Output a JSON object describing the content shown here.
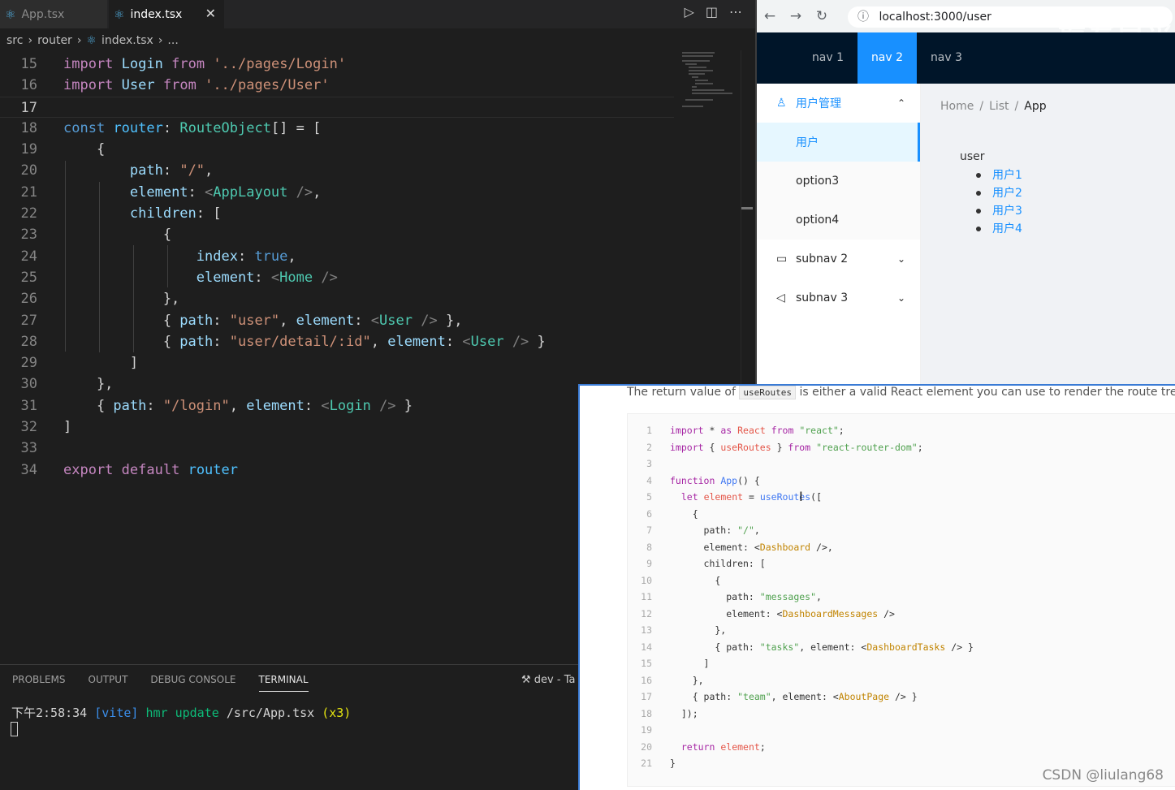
{
  "editor": {
    "tabs": [
      {
        "label": "App.tsx"
      },
      {
        "label": "index.tsx"
      }
    ],
    "breadcrumb": [
      "src",
      "router",
      "index.tsx",
      "..."
    ],
    "lines": [
      {
        "no": "15",
        "html": "<span class='kw'>import</span> <span class='vr'>Login</span> <span class='kw'>from</span> <span class='st'>'../pages/Login'</span>"
      },
      {
        "no": "16",
        "html": "<span class='kw'>import</span> <span class='vr'>User</span> <span class='kw'>from</span> <span class='st'>'../pages/User'</span>"
      },
      {
        "no": "17",
        "html": ""
      },
      {
        "no": "18",
        "html": "<span class='bl'>const</span> <span class='cn'>router</span>: <span class='ty'>RouteObject</span>[] = ["
      },
      {
        "no": "19",
        "html": "    {"
      },
      {
        "no": "20",
        "html": "        <span class='vr'>path</span>: <span class='st'>\"/\"</span>,"
      },
      {
        "no": "21",
        "html": "        <span class='vr'>element</span>: <span class='tg'>&lt;</span><span class='ty'>AppLayout</span> <span class='tg'>/&gt;</span>,"
      },
      {
        "no": "22",
        "html": "        <span class='vr'>children</span>: ["
      },
      {
        "no": "23",
        "html": "            {"
      },
      {
        "no": "24",
        "html": "                <span class='vr'>index</span>: <span class='bl'>true</span>,"
      },
      {
        "no": "25",
        "html": "                <span class='vr'>element</span>: <span class='tg'>&lt;</span><span class='ty'>Home</span> <span class='tg'>/&gt;</span>"
      },
      {
        "no": "26",
        "html": "            },"
      },
      {
        "no": "27",
        "html": "            { <span class='vr'>path</span>: <span class='st'>\"user\"</span>, <span class='vr'>element</span>: <span class='tg'>&lt;</span><span class='ty'>User</span> <span class='tg'>/&gt;</span> },"
      },
      {
        "no": "28",
        "html": "            { <span class='vr'>path</span>: <span class='st'>\"user/detail/:id\"</span>, <span class='vr'>element</span>: <span class='tg'>&lt;</span><span class='ty'>User</span> <span class='tg'>/&gt;</span> }"
      },
      {
        "no": "29",
        "html": "        ]"
      },
      {
        "no": "30",
        "html": "    },"
      },
      {
        "no": "31",
        "html": "    { <span class='vr'>path</span>: <span class='st'>\"/login\"</span>, <span class='vr'>element</span>: <span class='tg'>&lt;</span><span class='ty'>Login</span> <span class='tg'>/&gt;</span> }"
      },
      {
        "no": "32",
        "html": "]"
      },
      {
        "no": "33",
        "html": ""
      },
      {
        "no": "34",
        "html": "<span class='kw'>export</span> <span class='kw'>default</span> <span class='cn'>router</span>"
      }
    ]
  },
  "panel": {
    "tabs": [
      "PROBLEMS",
      "OUTPUT",
      "DEBUG CONSOLE",
      "TERMINAL"
    ],
    "dev_label": "dev - Ta",
    "term_time": "下午2:58:34",
    "term_vite": "[vite]",
    "term_hmr": "hmr update",
    "term_path": "/src/App.tsx",
    "term_count": "(x3)"
  },
  "browser": {
    "url": "localhost:3000/user",
    "watermark": "最爱白菜",
    "nav": [
      "nav 1",
      "nav 2",
      "nav 3"
    ],
    "menu_group": "用户管理",
    "menu_items": [
      "用户",
      "option3",
      "option4"
    ],
    "subnav2": "subnav 2",
    "subnav3": "subnav 3",
    "breadcrumb": [
      "Home",
      "List",
      "App"
    ],
    "user_title": "user",
    "users": [
      "用户1",
      "用户2",
      "用户3",
      "用户4"
    ]
  },
  "docs": {
    "desc_before": "The return value of",
    "desc_code": "useRoutes",
    "desc_after": "is either a valid React element you can use to render the route tree,",
    "lines": [
      {
        "no": "1",
        "html": "<span class='d-kw'>import</span> * <span class='d-kw'>as</span> <span class='d-id'>React</span> <span class='d-kw'>from</span> <span class='d-st'>\"react\"</span>;"
      },
      {
        "no": "2",
        "html": "<span class='d-kw'>import</span> { <span class='d-id'>useRoutes</span> } <span class='d-kw'>from</span> <span class='d-st'>\"react-router-dom\"</span>;"
      },
      {
        "no": "3",
        "html": ""
      },
      {
        "no": "4",
        "html": "<span class='d-kw'>function</span> <span class='d-fn'>App</span>() {"
      },
      {
        "no": "5",
        "html": "  <span class='d-kw'>let</span> <span class='d-id'>element</span> = <span class='d-fn'>useRoutes</span>(["
      },
      {
        "no": "6",
        "html": "    {"
      },
      {
        "no": "7",
        "html": "      path: <span class='d-st'>\"/\"</span>,"
      },
      {
        "no": "8",
        "html": "      element: &lt;<span class='d-tg'>Dashboard</span> /&gt;,"
      },
      {
        "no": "9",
        "html": "      children: ["
      },
      {
        "no": "10",
        "html": "        {"
      },
      {
        "no": "11",
        "html": "          path: <span class='d-st'>\"messages\"</span>,"
      },
      {
        "no": "12",
        "html": "          element: &lt;<span class='d-tg'>DashboardMessages</span> /&gt;"
      },
      {
        "no": "13",
        "html": "        },"
      },
      {
        "no": "14",
        "html": "        { path: <span class='d-st'>\"tasks\"</span>, element: &lt;<span class='d-tg'>DashboardTasks</span> /&gt; }"
      },
      {
        "no": "15",
        "html": "      ]"
      },
      {
        "no": "16",
        "html": "    },"
      },
      {
        "no": "17",
        "html": "    { path: <span class='d-st'>\"team\"</span>, element: &lt;<span class='d-tg'>AboutPage</span> /&gt; }"
      },
      {
        "no": "18",
        "html": "  ]);"
      },
      {
        "no": "19",
        "html": ""
      },
      {
        "no": "20",
        "html": "  <span class='d-kw'>return</span> <span class='d-id'>element</span>;"
      },
      {
        "no": "21",
        "html": "}"
      }
    ],
    "watermark": "CSDN @liulang68"
  },
  "colors": {
    "accent": "#1890ff",
    "nav_bg": "#001529",
    "editor_bg": "#1e1e1e"
  }
}
